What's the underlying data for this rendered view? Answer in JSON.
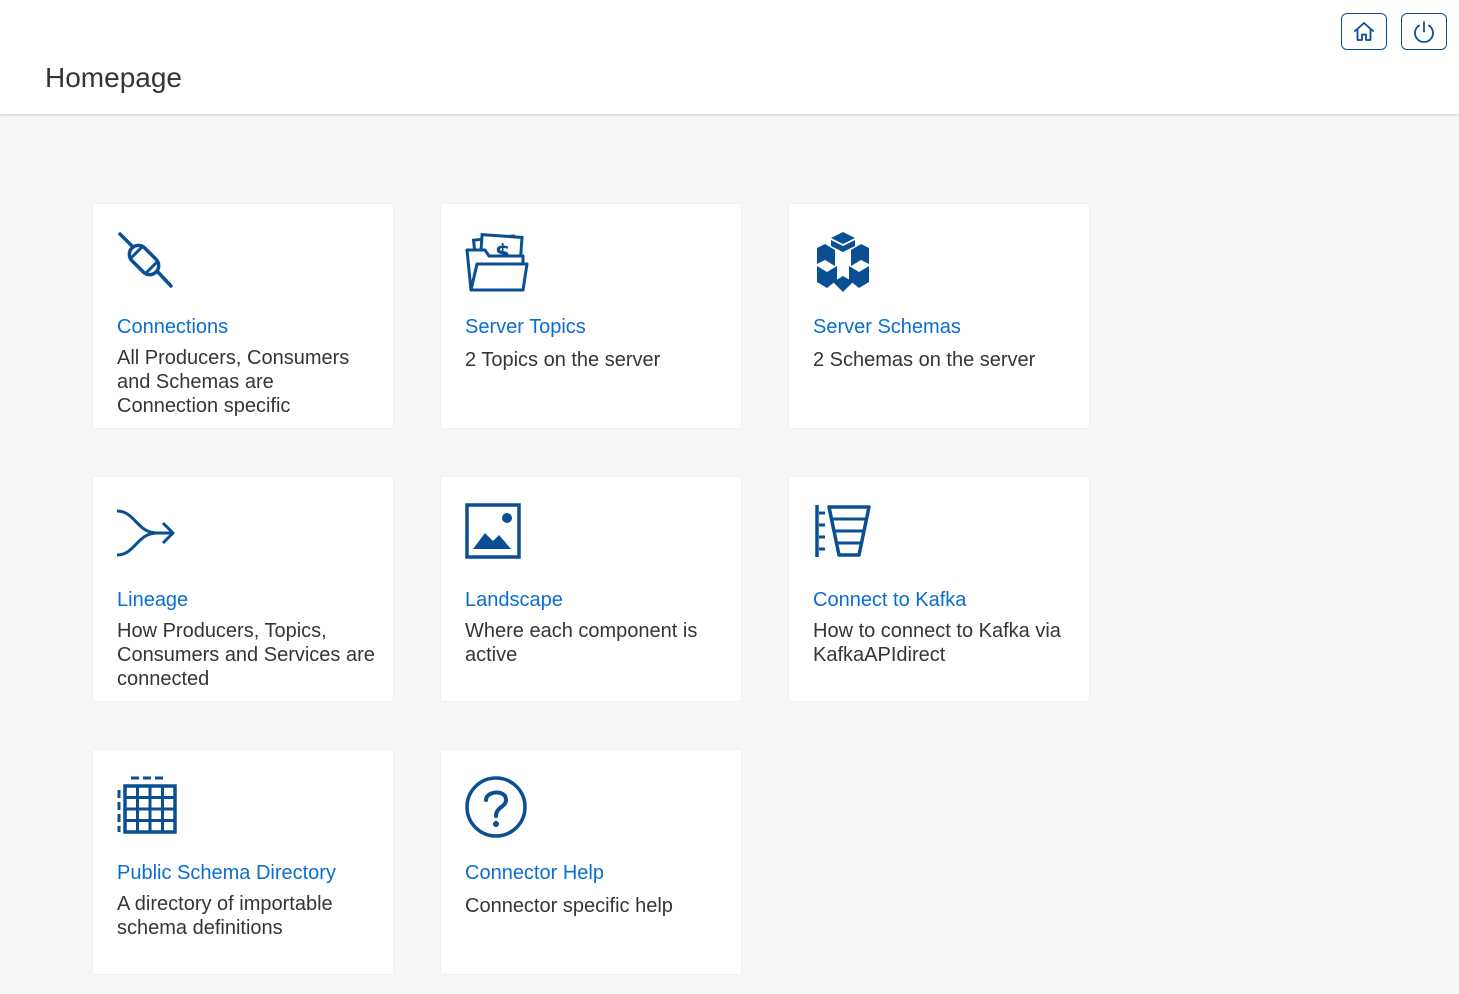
{
  "header": {
    "title": "Homepage",
    "home_button_icon": "home-icon",
    "power_button_icon": "power-icon"
  },
  "colors": {
    "accent": "#0a6ed1",
    "icon": "#0a4f93",
    "text": "#32363a",
    "background": "#f7f7f7"
  },
  "tiles": [
    {
      "icon": "connection-icon",
      "title": "Connections",
      "description": "All Producers, Consumers and Schemas are Connection specific"
    },
    {
      "icon": "folder-money-icon",
      "title": "Server Topics",
      "description": "2 Topics on the server"
    },
    {
      "icon": "hexagon-cubes-icon",
      "title": "Server Schemas",
      "description": "2 Schemas on the server"
    },
    {
      "icon": "merge-arrow-icon",
      "title": "Lineage",
      "description": "How Producers, Topics, Consumers and Services are connected"
    },
    {
      "icon": "landscape-image-icon",
      "title": "Landscape",
      "description": "Where each component is active"
    },
    {
      "icon": "funnel-list-icon",
      "title": "Connect to Kafka",
      "description": "How to connect to Kafka via KafkaAPIdirect"
    },
    {
      "icon": "table-grid-icon",
      "title": "Public Schema Directory",
      "description": "A directory of importable schema definitions"
    },
    {
      "icon": "question-mark-icon",
      "title": "Connector Help",
      "description": "Connector specific help"
    }
  ]
}
